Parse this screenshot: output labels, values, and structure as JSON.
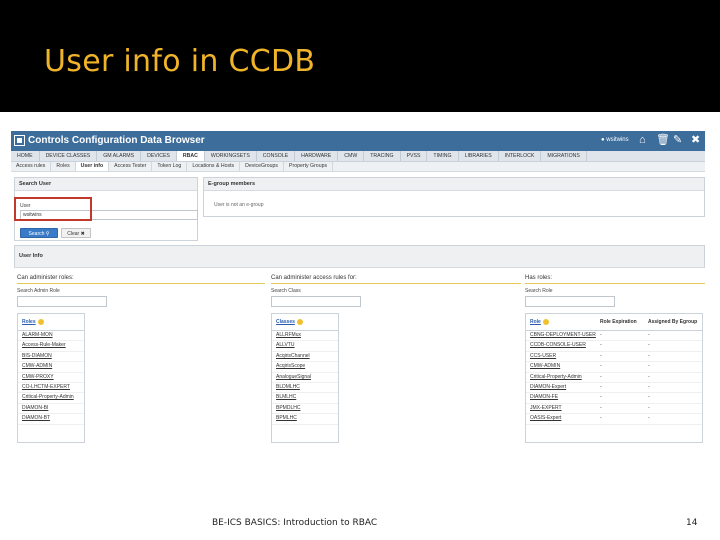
{
  "slide": {
    "title": "User info in CCDB",
    "footer": "BE-ICS BASICS: Introduction to RBAC",
    "page_number": "14",
    "title_color": "#f0b429"
  },
  "app": {
    "title": "Controls Configuration Data Browser",
    "username": "wsitwins",
    "icons": [
      "user-icon",
      "home-icon",
      "trash-icon",
      "edit-icon",
      "close-icon"
    ],
    "menu": [
      "HOME",
      "DEVICE CLASSES",
      "GM ALARMS",
      "DEVICES",
      "RBAC",
      "WORKINGSETS",
      "CONSOLE",
      "HARDWARE",
      "CMW",
      "TRACING",
      "PVSS",
      "TIMING",
      "LIBRARIES",
      "INTERLOCK",
      "MIGRATIONS"
    ],
    "menu_active": "RBAC",
    "submenu": [
      "Access rules",
      "Roles",
      "User info",
      "Access Tester",
      "Token Log",
      "Locations & Hosts",
      "DeviceGroups",
      "Property Groups"
    ],
    "submenu_active": "User info"
  },
  "search_user": {
    "title": "Search User",
    "user_label": "User",
    "user_value": "wsitwins",
    "search_button": "Search",
    "clear_button": "Clear"
  },
  "egroup": {
    "title": "E-group members",
    "message": "User is not an e-group"
  },
  "user_info": {
    "title": "User Info",
    "admin_roles": {
      "heading": "Can administer roles:",
      "search_label": "Search Admin Role",
      "column": "Roles",
      "rows": [
        "ALARM-MON",
        "Access-Rule-Maker",
        "BIS-DIAMON",
        "CMW-ADMIN",
        "CMW-PROXY",
        "CO-LHCTM-EXPERT",
        "Critical-Property-Admin",
        "DIAMON-BI",
        "DIAMON-BT"
      ]
    },
    "access_rules": {
      "heading": "Can administer access rules for:",
      "search_label": "Search Class",
      "column": "Classes",
      "rows": [
        "ALLRFMux",
        "ALLVTU",
        "AcqirisChannel",
        "AcqirisScope",
        "AnalogueSignal",
        "BLDMLHC",
        "BLMLHC",
        "BPMDLHC",
        "BPMLHC"
      ]
    },
    "has_roles": {
      "heading": "Has roles:",
      "search_label": "Search Role",
      "columns": [
        "Role",
        "Role Expiration",
        "Assigned By Egroup"
      ],
      "rows": [
        {
          "role": "CBNG-DEPLOYMENT-USER",
          "expiration": "-",
          "egroup": "-"
        },
        {
          "role": "CCDB-CONSOLE-USER",
          "expiration": "-",
          "egroup": "-"
        },
        {
          "role": "CCS-USER",
          "expiration": "-",
          "egroup": "-"
        },
        {
          "role": "CMW-ADMIN",
          "expiration": "-",
          "egroup": "-"
        },
        {
          "role": "Critical-Property-Admin",
          "expiration": "-",
          "egroup": "-"
        },
        {
          "role": "DIAMON-Expert",
          "expiration": "-",
          "egroup": "-"
        },
        {
          "role": "DIAMON-FE",
          "expiration": "-",
          "egroup": "-"
        },
        {
          "role": "JMX-EXPERT",
          "expiration": "-",
          "egroup": "-"
        },
        {
          "role": "OASIS-Expert",
          "expiration": "-",
          "egroup": "-"
        }
      ]
    }
  }
}
